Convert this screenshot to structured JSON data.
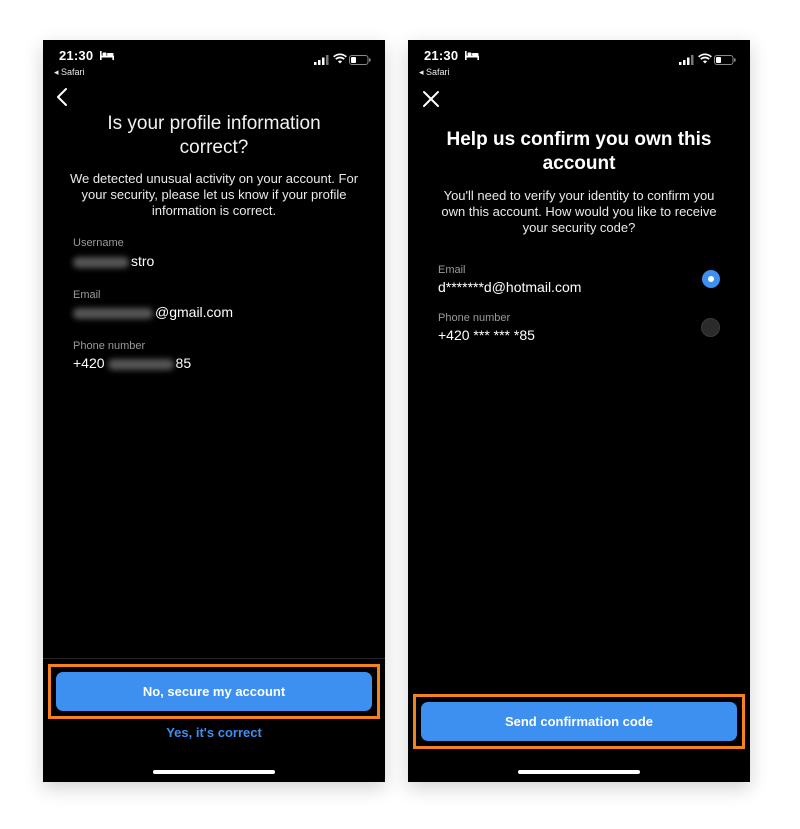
{
  "status_bar": {
    "time": "21:30",
    "back_app": "◂ Safari"
  },
  "screen1": {
    "title": "Is your profile information correct?",
    "description": "We detected unusual activity on your account. For your security, please let us know if your profile information is correct.",
    "fields": [
      {
        "label": "Username",
        "value_suffix": "stro"
      },
      {
        "label": "Email",
        "value_suffix": "@gmail.com"
      },
      {
        "label": "Phone number",
        "value_prefix": "+420",
        "value_suffix": "85"
      }
    ],
    "primary_button": "No, secure my account",
    "secondary_link": "Yes, it's correct"
  },
  "screen2": {
    "title": "Help us confirm you own this account",
    "description": "You'll need to verify your identity to confirm you own this account. How would you like to receive your security code?",
    "options": [
      {
        "label": "Email",
        "value": "d*******d@hotmail.com",
        "selected": true
      },
      {
        "label": "Phone number",
        "value": "+420 *** *** *85",
        "selected": false
      }
    ],
    "primary_button": "Send confirmation code"
  },
  "colors": {
    "accent": "#3d8ff0",
    "highlight": "#f5821f",
    "background": "#000000"
  }
}
